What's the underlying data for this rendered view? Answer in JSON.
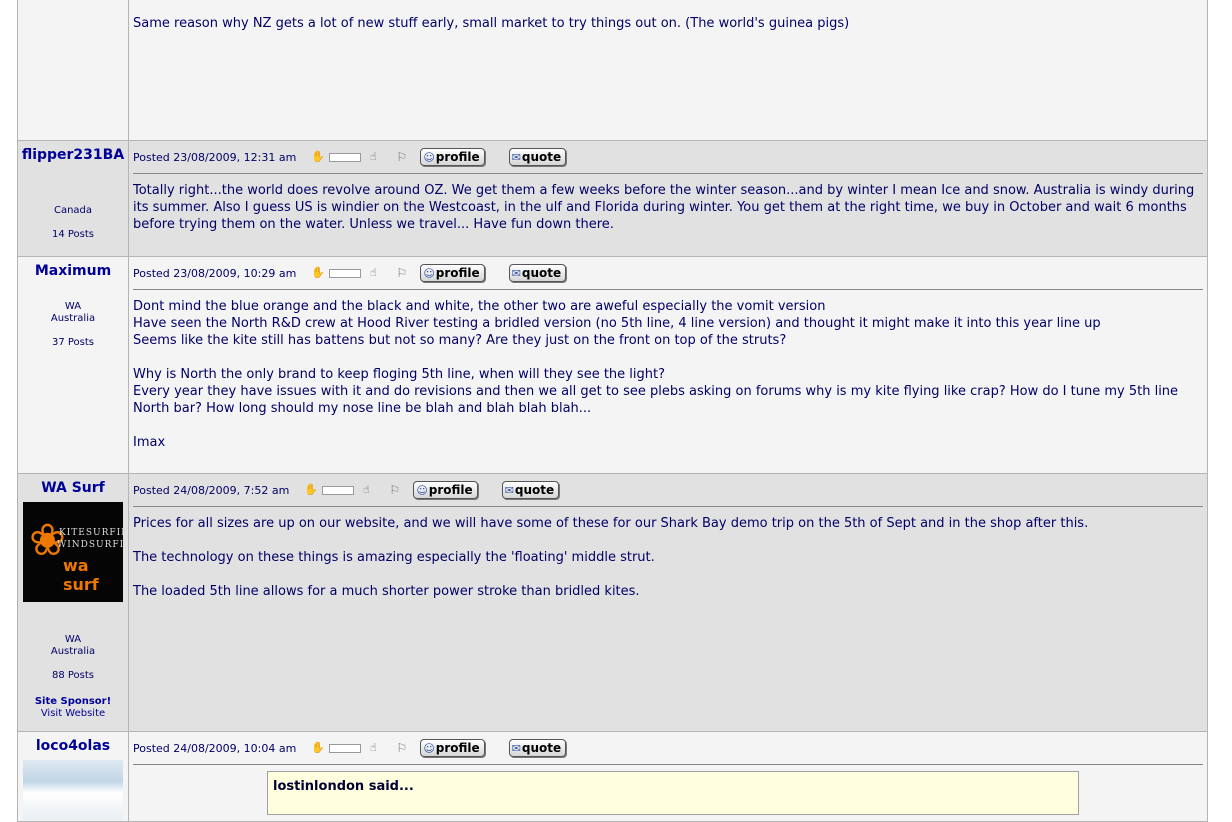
{
  "posts": [
    {
      "username": "",
      "body": [
        "Same reason why NZ gets a lot of new stuff early, small market to try things out on. (The world's guinea pigs)"
      ]
    },
    {
      "username": "flipper231BA",
      "location": "Canada",
      "posts_count": "14 Posts",
      "posted": "Posted 23/08/2009, 12:31 am",
      "body": [
        "Totally right...the world does revolve around OZ. We get them a few weeks before the winter season...and by winter I mean Ice and snow. Australia is windy during its summer. Also I guess US is windier on the Westcoast, in the ulf and Florida during winter. You get them at the right time, we buy in October and wait 6 months before trying them on the water. Unless we travel... Have fun down there."
      ]
    },
    {
      "username": "Maximum",
      "location_line1": "WA",
      "location_line2": "Australia",
      "posts_count": "37 Posts",
      "posted": "Posted 23/08/2009, 10:29 am",
      "body": [
        "Dont mind the blue orange and the black and white, the other two are aweful especially the vomit version\nHave seen the North R&D crew at Hood River testing a bridled version (no 5th line, 4 line version) and thought it might make it into this year line up\nSeems like the kite still has battens but not so many? Are they just on the front on top of the struts?",
        "Why is North the only brand to keep floging 5th line, when will they see the light?\nEvery year they have issues with it and do revisions and then we all get to see plebs asking on forums why is my kite flying like crap? How do I tune my 5th line North bar? How long should my nose line be blah and blah blah blah...",
        "Imax"
      ]
    },
    {
      "username": "WA Surf",
      "avatar_text": [
        "KITESURFIN",
        "WINDSURFI",
        "wa surf"
      ],
      "location_line1": "WA",
      "location_line2": "Australia",
      "posts_count": "88 Posts",
      "sponsor": "Site Sponsor!",
      "website": "Visit Website",
      "posted": "Posted 24/08/2009, 7:52 am",
      "body": [
        "Prices for all sizes are up on our website, and we will have some of these for our Shark Bay demo trip on the 5th of Sept and in the shop after this.",
        "The technology on these things is amazing especially the 'floating' middle strut.",
        "The loaded 5th line allows for a much shorter power stroke than bridled kites."
      ]
    },
    {
      "username": "loco4olas",
      "posted": "Posted 24/08/2009, 10:04 am",
      "quote_author": "lostinlondon said..."
    }
  ],
  "buttons": {
    "profile": "profile",
    "quote": "quote"
  },
  "colors": {
    "text": "#000066",
    "username": "#000099",
    "row_light": "#f4f4f4",
    "row_dark": "#e1e1e1",
    "quote_bg": "#ffffe0",
    "wasurf_orange": "#ee7700"
  }
}
